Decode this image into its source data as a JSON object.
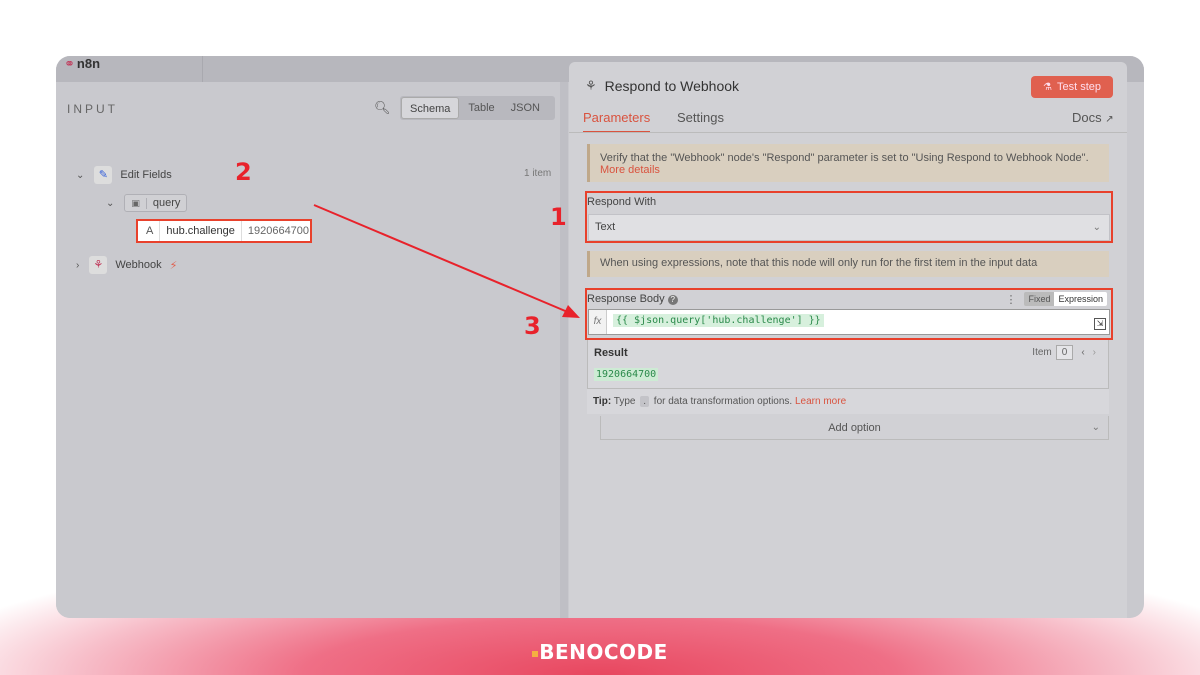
{
  "app": {
    "brand": "n8n"
  },
  "input_panel": {
    "title": "INPUT",
    "view_tabs": [
      "Schema",
      "Table",
      "JSON"
    ],
    "active_view": "Schema",
    "item_count": "1 item",
    "tree": {
      "edit_fields": "Edit Fields",
      "query": "query",
      "field_type": "A",
      "field_key": "hub.challenge",
      "field_value": "1920664700",
      "webhook": "Webhook"
    }
  },
  "node_panel": {
    "title": "Respond to Webhook",
    "test_button": "Test step",
    "tabs": {
      "parameters": "Parameters",
      "settings": "Settings",
      "docs": "Docs"
    },
    "notice_1": "Verify that the \"Webhook\" node's \"Respond\" parameter is set to \"Using Respond to Webhook Node\".",
    "notice_1_link": "More details",
    "respond_with": {
      "label": "Respond With",
      "value": "Text"
    },
    "notice_2": "When using expressions, note that this node will only run for the first item in the input data",
    "response_body": {
      "label": "Response Body",
      "mode_fixed": "Fixed",
      "mode_expression": "Expression",
      "fx": "fx",
      "expression": "{{ $json.query['hub.challenge'] }}"
    },
    "result": {
      "label": "Result",
      "item_label": "Item",
      "item_index": "0",
      "value": "1920664700"
    },
    "tip": {
      "label": "Tip:",
      "pre": "Type",
      "key": ".",
      "post": "for data transformation options.",
      "link": "Learn more"
    },
    "add_option": "Add option"
  },
  "annotations": [
    "1",
    "2",
    "3"
  ],
  "footer": {
    "logo": "BENOCODE"
  },
  "colors": {
    "highlight": "#e8412c",
    "accent": "#d9533f",
    "expression_green": "#2a8a4a"
  }
}
